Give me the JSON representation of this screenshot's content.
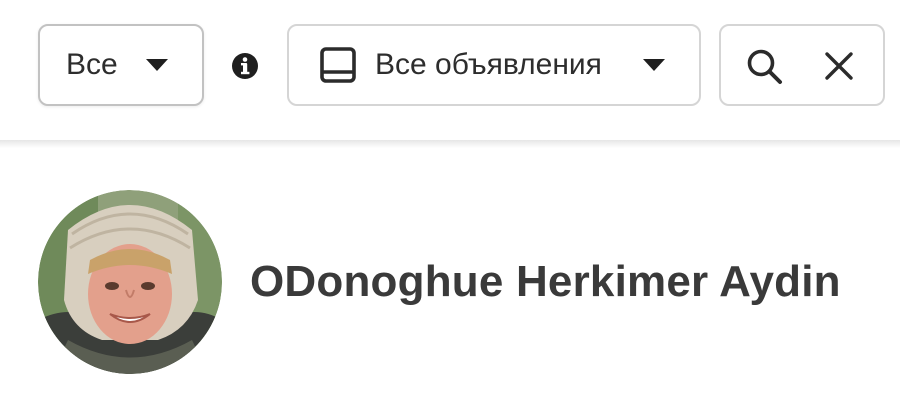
{
  "toolbar": {
    "filter_dropdown": {
      "selected": "Все",
      "icon": "caret-down-icon"
    },
    "info_icon": "info-icon",
    "scope_dropdown": {
      "selected": "Все объявления",
      "leading_icon": "book-icon",
      "icon": "caret-down-icon"
    },
    "search": {
      "search_icon": "search-icon",
      "clear_icon": "close-icon"
    }
  },
  "profile": {
    "name": "ODonoghue Herkimer Aydin",
    "avatar": "avatar-photo"
  },
  "colors": {
    "text": "#2d2d2d",
    "border": "#d5d5d5",
    "icon": "#1f1f1f",
    "background": "#ffffff"
  }
}
